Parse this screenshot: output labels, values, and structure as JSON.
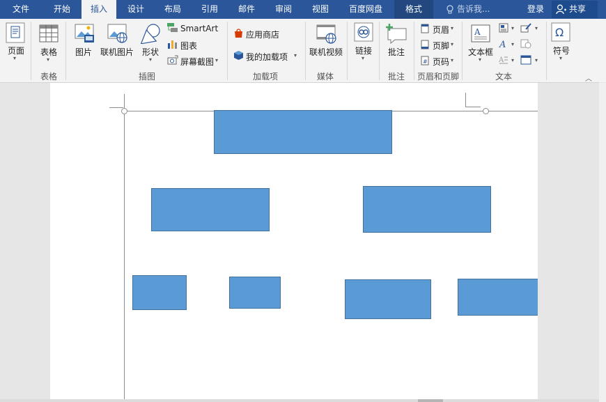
{
  "tabs": [
    {
      "label": "文件"
    },
    {
      "label": "开始"
    },
    {
      "label": "插入"
    },
    {
      "label": "设计"
    },
    {
      "label": "布局"
    },
    {
      "label": "引用"
    },
    {
      "label": "邮件"
    },
    {
      "label": "审阅"
    },
    {
      "label": "视图"
    },
    {
      "label": "百度网盘"
    },
    {
      "label": "格式"
    }
  ],
  "active_tab": "插入",
  "tell_me": "告诉我...",
  "sign_in": "登录",
  "share": "共享",
  "ribbon": {
    "pages": {
      "label": "页面"
    },
    "table": {
      "label": "表格",
      "group": "表格"
    },
    "illustrations": {
      "group": "插图",
      "picture": "图片",
      "online_picture": "联机图片",
      "shapes": "形状",
      "smartart": "SmartArt",
      "chart": "图表",
      "screenshot": "屏幕截图"
    },
    "addins": {
      "group": "加载项",
      "store": "应用商店",
      "my_addins": "我的加载项"
    },
    "media": {
      "group": "媒体",
      "online_video": "联机视频"
    },
    "links": {
      "label": "链接"
    },
    "comments": {
      "group": "批注",
      "comment": "批注"
    },
    "header_footer": {
      "group": "页眉和页脚",
      "header": "页眉",
      "footer": "页脚",
      "page_number": "页码"
    },
    "text": {
      "group": "文本",
      "text_box": "文本框"
    },
    "symbols": {
      "label": "符号"
    }
  },
  "colors": {
    "title_bar": "#2b579a",
    "ribbon": "#f3f3f3",
    "shape_fill": "#5b9bd5",
    "shape_border": "#41719c"
  }
}
